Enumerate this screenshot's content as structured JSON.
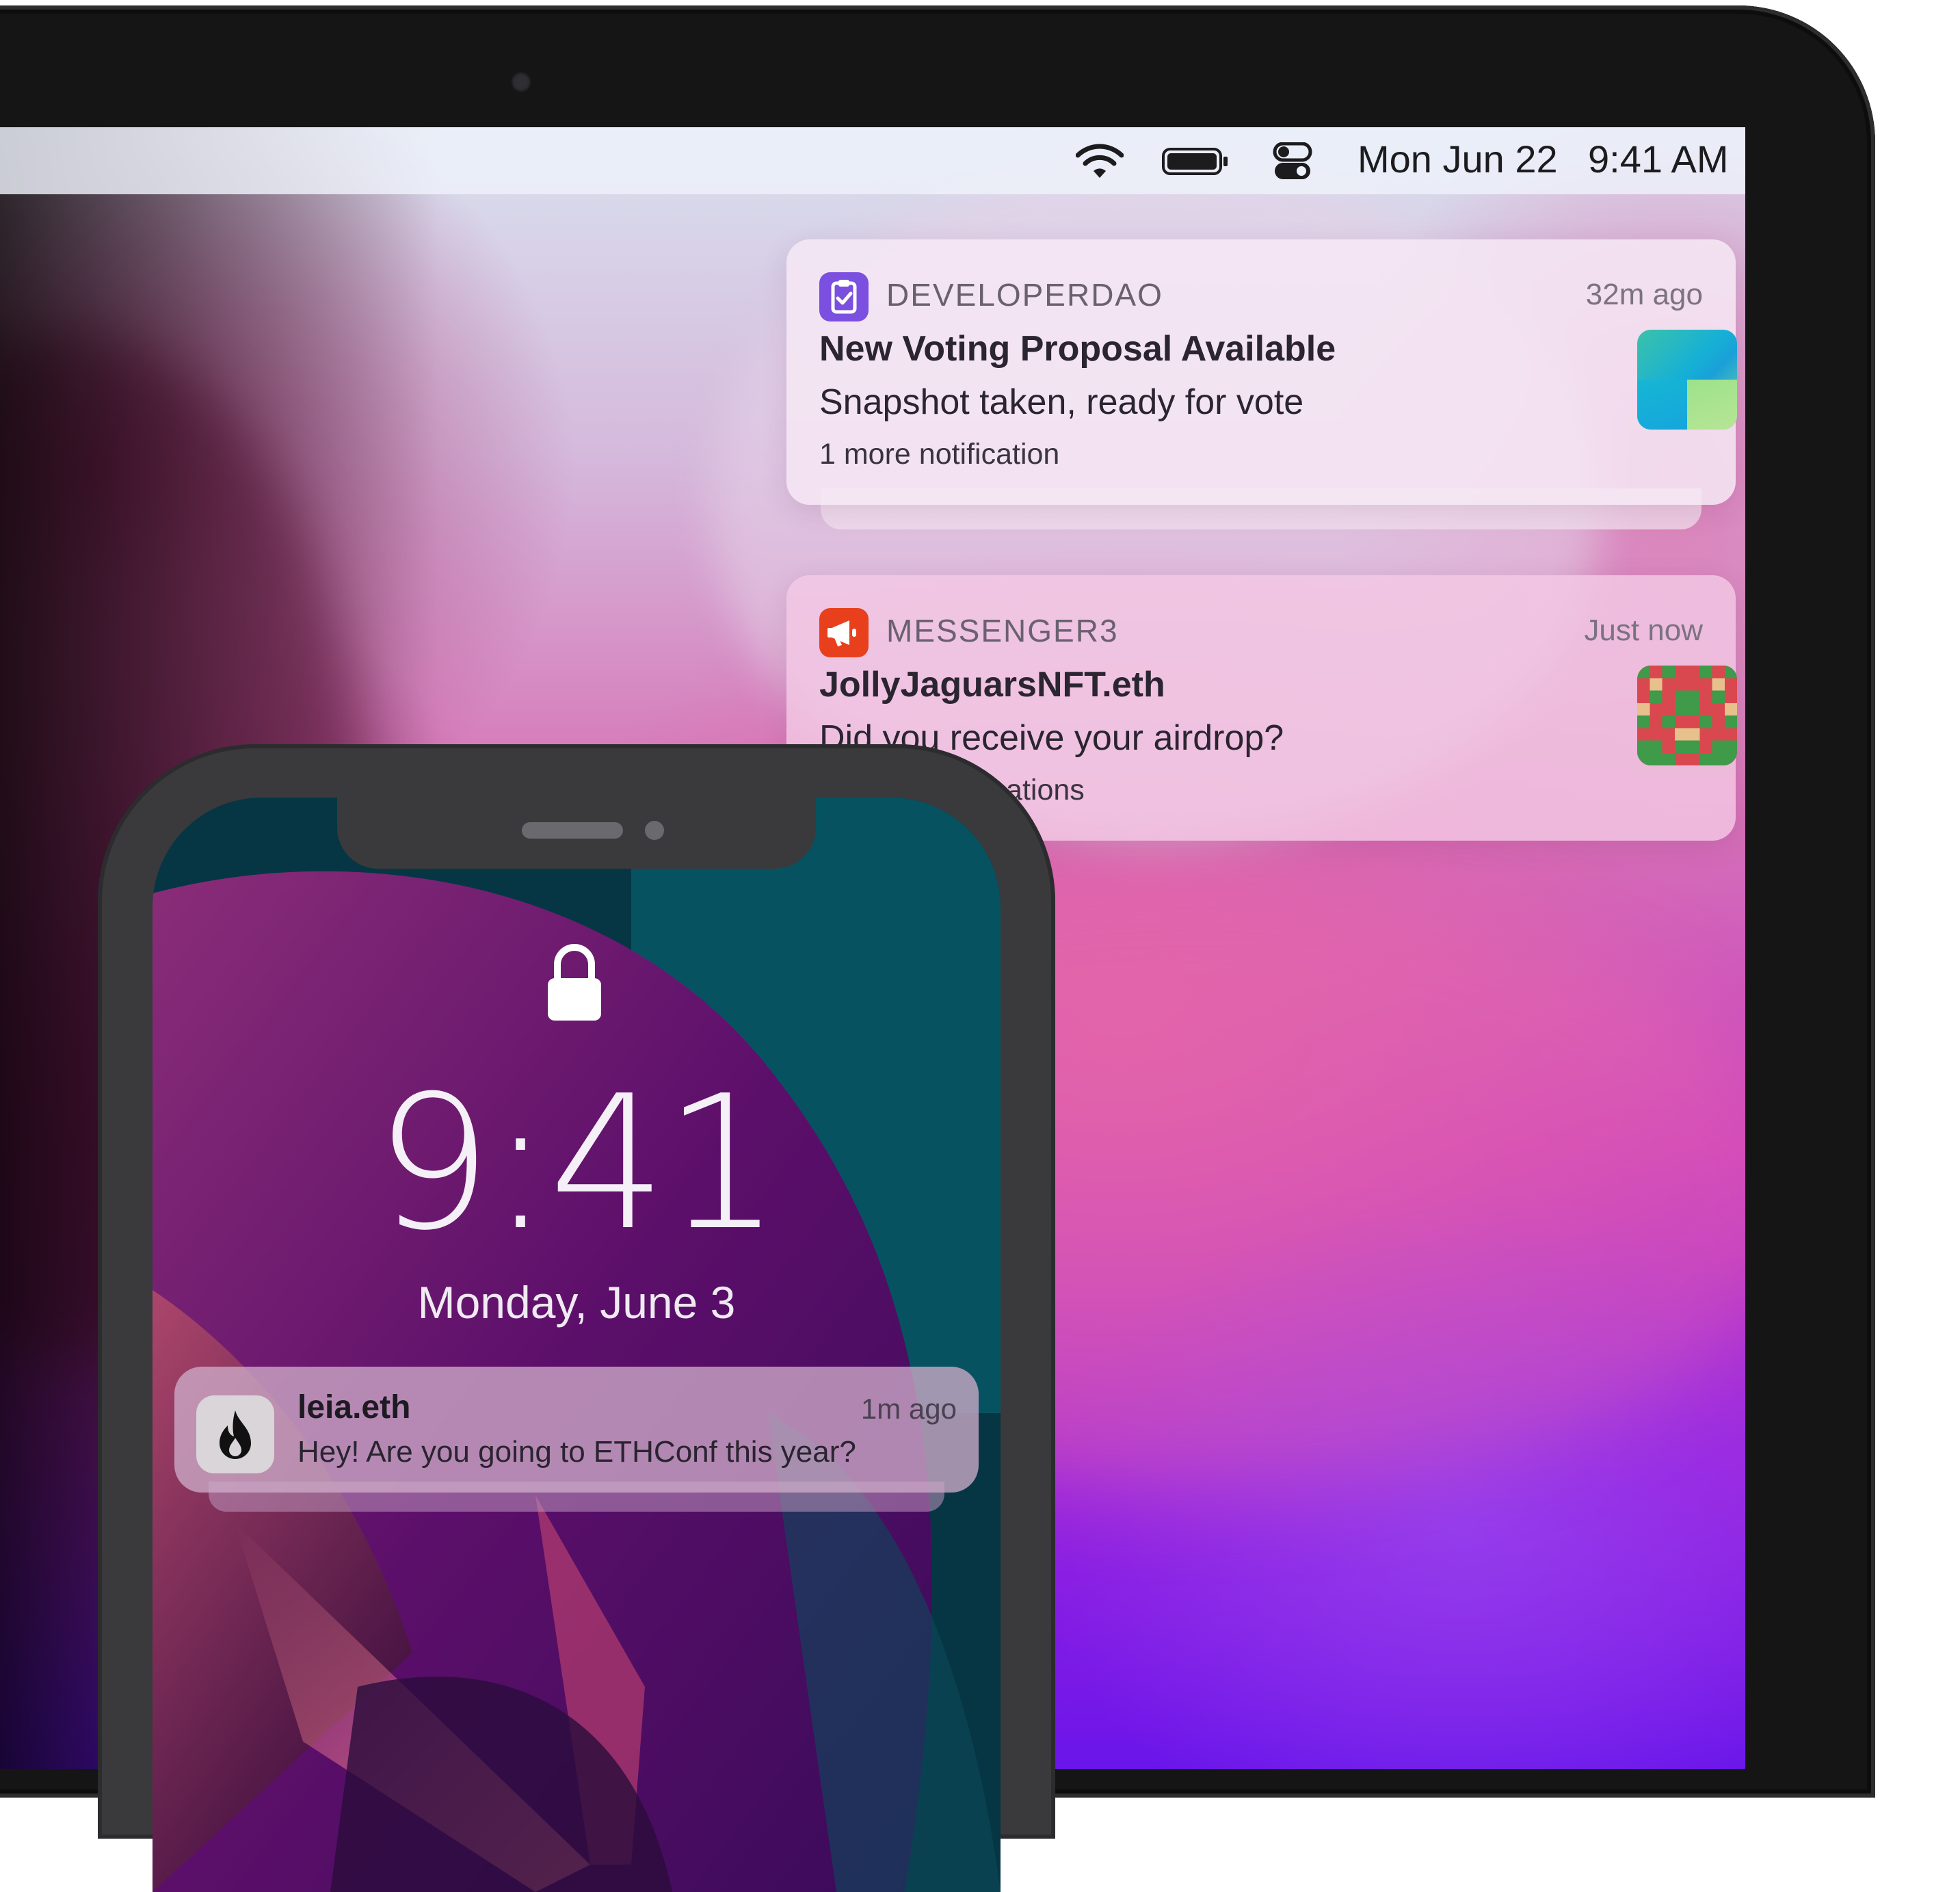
{
  "menubar": {
    "date": "Mon Jun 22",
    "time": "9:41 AM",
    "icons": [
      "wifi-icon",
      "battery-icon",
      "control-center-icon"
    ]
  },
  "notifications": [
    {
      "app": "DEVELOPERDAO",
      "app_icon": "clipboard-check-icon",
      "app_color": "#7b4fe0",
      "time": "32m ago",
      "title": "New Voting Proposal Available",
      "body": "Snapshot taken, ready for vote",
      "more": "1 more notification",
      "thumbnail": "gradient-thumbnail"
    },
    {
      "app": "MESSENGER3",
      "app_icon": "megaphone-icon",
      "app_color": "#e8401c",
      "time": "Just now",
      "title": "JollyJaguarsNFT.eth",
      "body": "Did you receive your airdrop?",
      "more": "ications",
      "thumbnail": "pixel-art-nft-thumbnail"
    }
  ],
  "phone": {
    "lock_icon": "lock-icon",
    "clock": "9:41",
    "date": "Monday, June 3",
    "notification": {
      "app_icon": "flame-icon",
      "sender": "leia.eth",
      "time": "1m ago",
      "body": "Hey! Are you going to ETHConf this year?"
    }
  }
}
